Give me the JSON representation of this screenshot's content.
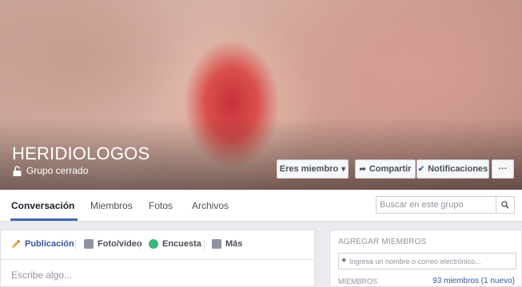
{
  "group": {
    "name": "HERIDIOLOGOS",
    "privacy": "Grupo cerrado"
  },
  "actions": {
    "member": "Eres miembro",
    "share": "Compartir",
    "notifications": "Notificaciones",
    "more": "···"
  },
  "tabs": [
    "Conversación",
    "Miembros",
    "Fotos",
    "Archivos"
  ],
  "search": {
    "placeholder": "Buscar en este grupo"
  },
  "composer": {
    "tabs": [
      "Publicación",
      "Foto/video",
      "Encuesta",
      "Más"
    ],
    "placeholder": "Escribe algo..."
  },
  "sidebar": {
    "add_members_title": "AGREGAR MIEMBROS",
    "add_members_placeholder": "Ingresa un nombre o correo electrónico...",
    "members_title": "MIEMBROS",
    "members_count": "93 miembros (1 nuevo)"
  },
  "colors": {
    "accent": "#4267b2",
    "link": "#365899"
  }
}
